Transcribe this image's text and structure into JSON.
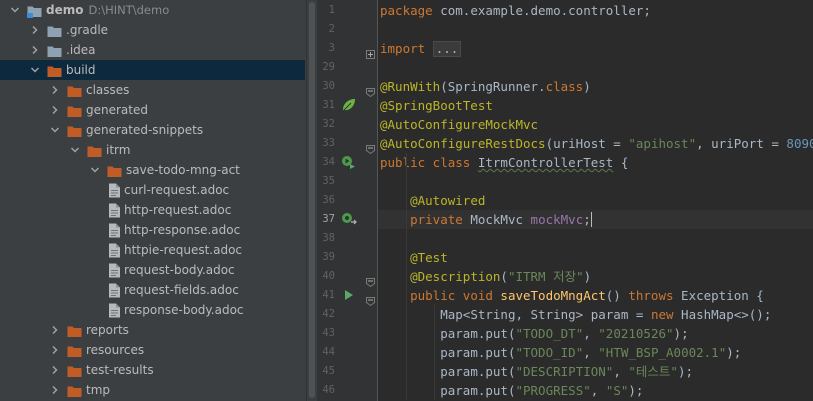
{
  "tree": {
    "items": [
      {
        "label": "demo",
        "path": "D:\\HINT\\demo",
        "kind": "module",
        "expanded": true,
        "color": "#bbbbbb"
      },
      {
        "label": ".gradle",
        "kind": "folder",
        "expanded": false,
        "color": "#bbbbbb"
      },
      {
        "label": ".idea",
        "kind": "folder",
        "expanded": false,
        "color": "#bbbbbb"
      },
      {
        "label": "build",
        "kind": "folder-excluded",
        "expanded": true,
        "color": "#bbbbbb",
        "selected": true
      },
      {
        "label": "classes",
        "kind": "folder-excluded",
        "expanded": false,
        "color": "#bbbbbb"
      },
      {
        "label": "generated",
        "kind": "folder-excluded",
        "expanded": false,
        "color": "#bbbbbb"
      },
      {
        "label": "generated-snippets",
        "kind": "folder-excluded",
        "expanded": true,
        "color": "#bbbbbb"
      },
      {
        "label": "itrm",
        "kind": "folder-excluded",
        "expanded": true,
        "color": "#bbbbbb"
      },
      {
        "label": "save-todo-mng-act",
        "kind": "folder-excluded",
        "expanded": true,
        "color": "#bbbbbb"
      },
      {
        "label": "curl-request.adoc",
        "kind": "file",
        "color": "#bbbbbb"
      },
      {
        "label": "http-request.adoc",
        "kind": "file",
        "color": "#bbbbbb"
      },
      {
        "label": "http-response.adoc",
        "kind": "file",
        "color": "#bbbbbb"
      },
      {
        "label": "httpie-request.adoc",
        "kind": "file",
        "color": "#bbbbbb"
      },
      {
        "label": "request-body.adoc",
        "kind": "file",
        "color": "#bbbbbb"
      },
      {
        "label": "request-fields.adoc",
        "kind": "file",
        "color": "#bbbbbb"
      },
      {
        "label": "response-body.adoc",
        "kind": "file",
        "color": "#bbbbbb"
      },
      {
        "label": "reports",
        "kind": "folder-excluded",
        "expanded": false,
        "color": "#bbbbbb"
      },
      {
        "label": "resources",
        "kind": "folder-excluded",
        "expanded": false,
        "color": "#bbbbbb"
      },
      {
        "label": "test-results",
        "kind": "folder-excluded",
        "expanded": false,
        "color": "#bbbbbb"
      },
      {
        "label": "tmp",
        "kind": "folder-excluded",
        "expanded": false,
        "color": "#bbbbbb"
      }
    ]
  },
  "editor": {
    "current_line": "37",
    "lines": [
      {
        "num": "1",
        "icon": null,
        "fold": null,
        "tokens": [
          [
            "kw",
            "package "
          ],
          [
            "",
            "com.example.demo.controller;"
          ]
        ]
      },
      {
        "num": "2",
        "icon": null,
        "fold": null,
        "tokens": []
      },
      {
        "num": "3",
        "icon": null,
        "fold": "plus",
        "tokens": [
          [
            "kw",
            "import "
          ],
          [
            "foldbox",
            "..."
          ]
        ]
      },
      {
        "num": "29",
        "icon": null,
        "fold": null,
        "tokens": []
      },
      {
        "num": "30",
        "icon": null,
        "fold": "open",
        "tokens": [
          [
            "an",
            "@RunWith"
          ],
          [
            "",
            "(SpringRunner."
          ],
          [
            "kw",
            "class"
          ],
          [
            "",
            ")"
          ]
        ]
      },
      {
        "num": "31",
        "icon": "spring-bean-icon",
        "fold": null,
        "tokens": [
          [
            "an",
            "@SpringBootTest"
          ]
        ]
      },
      {
        "num": "32",
        "icon": null,
        "fold": null,
        "tokens": [
          [
            "an",
            "@AutoConfigureMockMvc"
          ]
        ]
      },
      {
        "num": "33",
        "icon": null,
        "fold": "open",
        "tokens": [
          [
            "an",
            "@AutoConfigureRestDocs"
          ],
          [
            "",
            "(uriHost = "
          ],
          [
            "st",
            "\"apihost\""
          ],
          [
            "",
            ", uriPort = "
          ],
          [
            "nm",
            "8090"
          ],
          [
            "",
            ")"
          ]
        ]
      },
      {
        "num": "34",
        "icon": "run-test-class-icon",
        "fold": null,
        "tokens": [
          [
            "kw",
            "public class "
          ],
          [
            "wavy",
            "ItrmControllerTest"
          ],
          [
            "",
            " {"
          ]
        ]
      },
      {
        "num": "35",
        "icon": null,
        "fold": null,
        "tokens": []
      },
      {
        "num": "36",
        "icon": null,
        "fold": null,
        "tokens": [
          [
            "pad",
            "    "
          ],
          [
            "an",
            "@Autowired"
          ]
        ]
      },
      {
        "num": "37",
        "icon": "autowired-bean-icon",
        "fold": null,
        "tokens": [
          [
            "pad",
            "    "
          ],
          [
            "kw",
            "private "
          ],
          [
            "",
            "MockMvc "
          ],
          [
            "fd",
            "mockMvc"
          ],
          [
            "",
            ";"
          ],
          [
            "caret",
            ""
          ]
        ]
      },
      {
        "num": "38",
        "icon": null,
        "fold": null,
        "tokens": []
      },
      {
        "num": "39",
        "icon": null,
        "fold": null,
        "tokens": [
          [
            "pad",
            "    "
          ],
          [
            "an",
            "@Test"
          ]
        ]
      },
      {
        "num": "40",
        "icon": null,
        "fold": "open",
        "tokens": [
          [
            "pad",
            "    "
          ],
          [
            "an",
            "@Description"
          ],
          [
            "",
            "("
          ],
          [
            "st",
            "\"ITRM 저장\""
          ],
          [
            "",
            ")"
          ]
        ]
      },
      {
        "num": "41",
        "icon": "run-test-icon",
        "fold": "open",
        "tokens": [
          [
            "pad",
            "    "
          ],
          [
            "kw",
            "public void "
          ],
          [
            "fn",
            "saveTodoMngAct"
          ],
          [
            "",
            "() "
          ],
          [
            "kw",
            "throws "
          ],
          [
            "",
            "Exception {"
          ]
        ]
      },
      {
        "num": "42",
        "icon": null,
        "fold": null,
        "tokens": [
          [
            "pad",
            "        "
          ],
          [
            "",
            "Map<String, String> param = "
          ],
          [
            "kw",
            "new "
          ],
          [
            "",
            "HashMap<>();"
          ]
        ]
      },
      {
        "num": "43",
        "icon": null,
        "fold": null,
        "tokens": [
          [
            "pad",
            "        "
          ],
          [
            "",
            "param.put("
          ],
          [
            "st",
            "\"TODO_DT\""
          ],
          [
            "",
            ", "
          ],
          [
            "st",
            "\"20210526\""
          ],
          [
            "",
            ");"
          ]
        ]
      },
      {
        "num": "44",
        "icon": null,
        "fold": null,
        "tokens": [
          [
            "pad",
            "        "
          ],
          [
            "",
            "param.put("
          ],
          [
            "st",
            "\"TODO_ID\""
          ],
          [
            "",
            ", "
          ],
          [
            "st",
            "\"HTW_BSP_A0002.1\""
          ],
          [
            "",
            ");"
          ]
        ]
      },
      {
        "num": "45",
        "icon": null,
        "fold": null,
        "tokens": [
          [
            "pad",
            "        "
          ],
          [
            "",
            "param.put("
          ],
          [
            "st",
            "\"DESCRIPTION\""
          ],
          [
            "",
            ", "
          ],
          [
            "st",
            "\"테스트\""
          ],
          [
            "",
            ");"
          ]
        ]
      },
      {
        "num": "46",
        "icon": null,
        "fold": null,
        "tokens": [
          [
            "pad",
            "        "
          ],
          [
            "",
            "param.put("
          ],
          [
            "st",
            "\"PROGRESS\""
          ],
          [
            "",
            ", "
          ],
          [
            "st",
            "\"S\""
          ],
          [
            "",
            ");"
          ]
        ]
      }
    ]
  }
}
